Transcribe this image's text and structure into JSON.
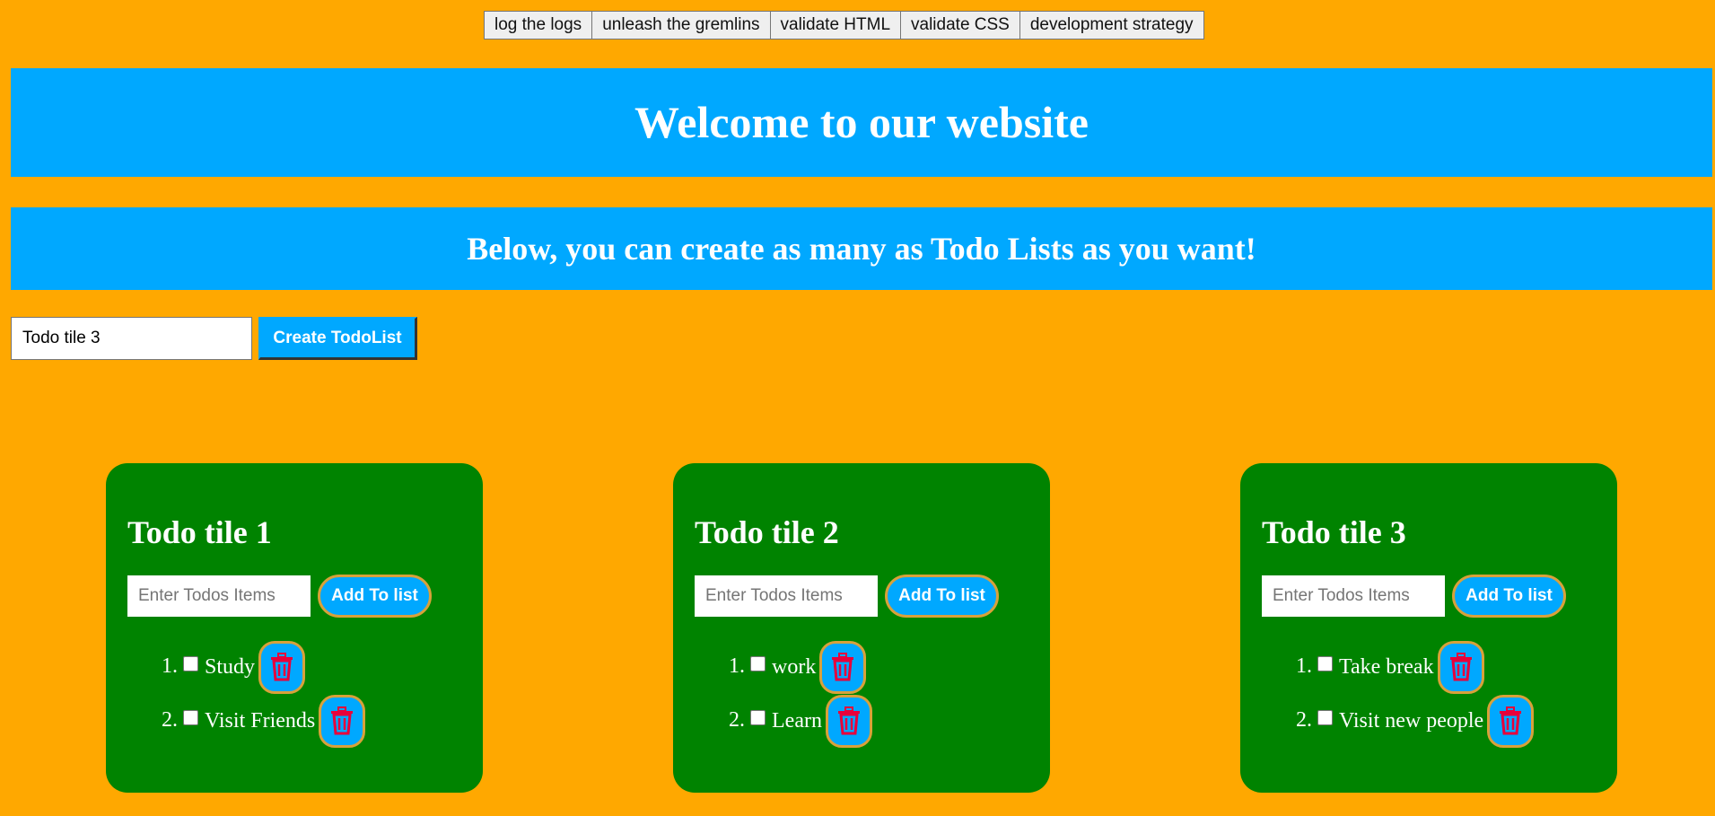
{
  "toolbar": {
    "buttons": [
      "log the logs",
      "unleash the gremlins",
      "validate HTML",
      "validate CSS",
      "development strategy"
    ]
  },
  "header": {
    "title": "Welcome to our website",
    "subtitle": "Below, you can create as many as Todo Lists as you want!"
  },
  "create": {
    "input_value": "Todo tile 3",
    "button_label": "Create TodoList"
  },
  "tiles": [
    {
      "title": "Todo tile 1",
      "placeholder": "Enter Todos Items",
      "add_label": "Add To list",
      "items": [
        {
          "text": "Study",
          "checked": false
        },
        {
          "text": "Visit Friends",
          "checked": false
        }
      ]
    },
    {
      "title": "Todo tile 2",
      "placeholder": "Enter Todos Items",
      "add_label": "Add To list",
      "items": [
        {
          "text": "work",
          "checked": false
        },
        {
          "text": "Learn",
          "checked": false
        }
      ]
    },
    {
      "title": "Todo tile 3",
      "placeholder": "Enter Todos Items",
      "add_label": "Add To list",
      "items": [
        {
          "text": "Take break",
          "checked": false
        },
        {
          "text": "Visit new people",
          "checked": false
        }
      ]
    }
  ],
  "colors": {
    "page_bg": "#ffa800",
    "banner": "#00a8ff",
    "tile": "#008300",
    "trash_icon": "#e8003a",
    "button_border": "#d8a13a"
  },
  "icons": {
    "delete": "trash-icon"
  }
}
